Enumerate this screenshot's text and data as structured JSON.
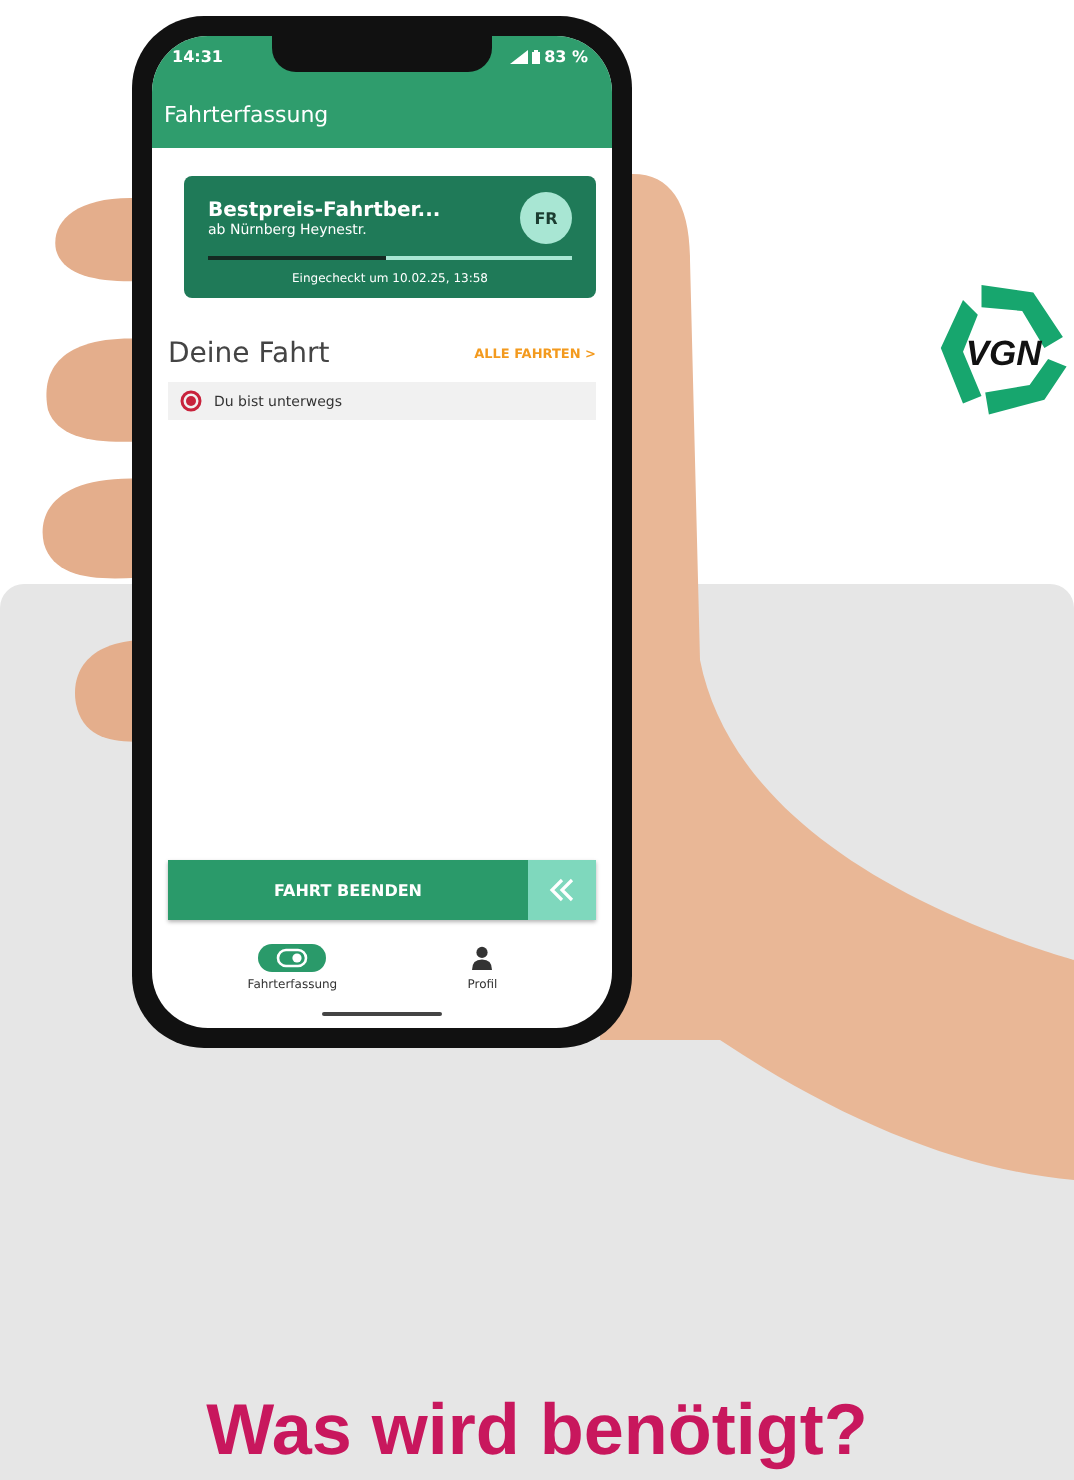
{
  "logo": {
    "text": "VGN"
  },
  "status_bar": {
    "time": "14:31",
    "battery": "83 %"
  },
  "app_bar": {
    "title": "Fahrterfassung"
  },
  "ticket": {
    "title": "Bestpreis-Fahrtber...",
    "subtitle": "ab Nürnberg Heynestr.",
    "badge": "FR",
    "level": 0.49,
    "checked_in": "Eingecheckt um 10.02.25, 13:58"
  },
  "trip": {
    "heading": "Deine Fahrt",
    "link": "ALLE FAHRTEN >",
    "status": "Du bist unterwegs"
  },
  "end_button": {
    "label": "FAHRT BEENDEN"
  },
  "nav": [
    {
      "label": "Fahrterfassung",
      "kind": "toggle",
      "selected": true
    },
    {
      "label": "Profil",
      "kind": "person",
      "selected": false
    }
  ],
  "heading": "Was wird benötigt?"
}
